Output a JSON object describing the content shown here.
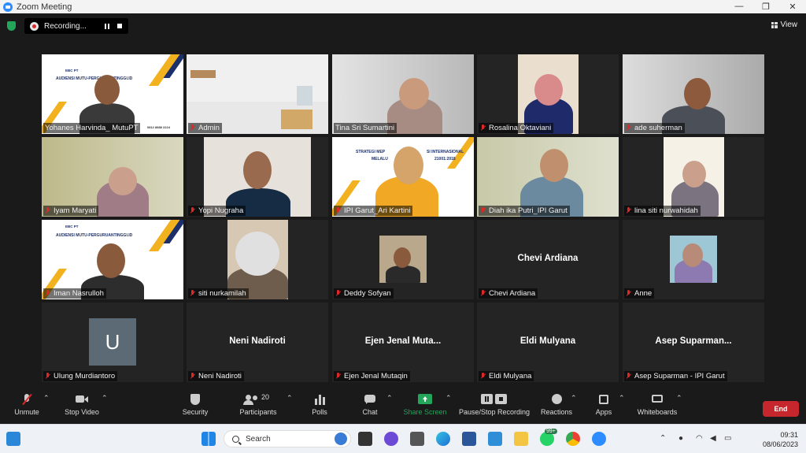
{
  "window": {
    "title": "Zoom Meeting",
    "controls": [
      "—",
      "❐",
      "✕"
    ]
  },
  "recording": {
    "label": "Recording...",
    "pause_label": "Pause recording",
    "stop_label": "Stop recording"
  },
  "view": {
    "label": "View"
  },
  "participants": [
    {
      "name": "Yohanes Harvinda_ MutuPT",
      "muted": false,
      "active": true
    },
    {
      "name": "Admin",
      "muted": true
    },
    {
      "name": "Tina Sri Sumartini",
      "muted": false
    },
    {
      "name": "Rosalina Oktaviani",
      "muted": true
    },
    {
      "name": "ade suherman",
      "muted": true
    },
    {
      "name": "Iyam Maryati",
      "muted": true
    },
    {
      "name": "Yopi Nugraha",
      "muted": true
    },
    {
      "name": "IPI Garut_Ari Kartini",
      "muted": true
    },
    {
      "name": "Diah ika Putri_IPI Garut",
      "muted": true
    },
    {
      "name": "lina siti nurwahidah",
      "muted": true
    },
    {
      "name": "Iman Nasrulloh",
      "muted": true
    },
    {
      "name": "siti nurkamilah",
      "muted": true
    },
    {
      "name": "Deddy Sofyan",
      "muted": true
    },
    {
      "name": "Chevi Ardiana",
      "muted": true,
      "center": "Chevi Ardiana"
    },
    {
      "name": "Anne",
      "muted": true
    },
    {
      "name": "Ulung Murdiantoro",
      "muted": true,
      "avatar": "U"
    },
    {
      "name": "Neni Nadiroti",
      "muted": true,
      "center": "Neni Nadiroti"
    },
    {
      "name": "Ejen Jenal Mutaqin",
      "muted": true,
      "center": "Ejen Jenal Muta..."
    },
    {
      "name": "Eldi Mulyana",
      "muted": true,
      "center": "Eldi Mulyana"
    },
    {
      "name": "Asep Suparman - IPI Garut",
      "muted": true,
      "center": "Asep Suparman..."
    }
  ],
  "slides": {
    "title1": "AUDIENSI MUTU-PERGURUANTINGGI.ID",
    "title2": "STRATEGI MEP",
    "title3": "SI INTERNASIONAL",
    "title4": "21001:2018",
    "title5": "MELALU",
    "logo": "EBC PT",
    "phone": "0812 8888 2224"
  },
  "toolbar": {
    "unmute": "Unmute",
    "stop_video": "Stop Video",
    "security": "Security",
    "participants": "Participants",
    "participants_count": "20",
    "polls": "Polls",
    "chat": "Chat",
    "share_screen": "Share Screen",
    "pause_stop_recording": "Pause/Stop Recording",
    "reactions": "Reactions",
    "apps": "Apps",
    "whiteboards": "Whiteboards",
    "end": "End"
  },
  "taskbar": {
    "search_placeholder": "Search",
    "whatsapp_badge": "99+",
    "time": "09:31",
    "date": "08/06/2023"
  },
  "colors": {
    "active_speaker": "#c4e04a",
    "end_button": "#c5272d",
    "share_green": "#23a55a",
    "muted_red": "#e02828"
  }
}
